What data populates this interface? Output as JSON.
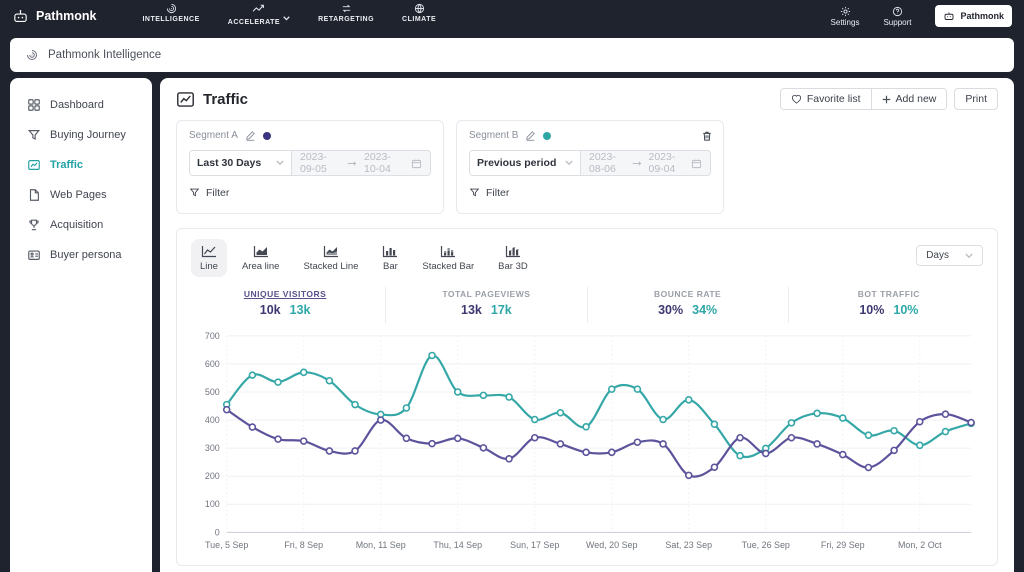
{
  "colors": {
    "navbar_bg": "#1F232E",
    "accent_teal": "#2FA7A7",
    "accent_purple": "#3D3870",
    "line_purple": "#5B539B",
    "line_teal": "#35A7A7"
  },
  "topnav": {
    "brand": "Pathmonk",
    "items": [
      {
        "label": "INTELLIGENCE"
      },
      {
        "label": "ACCELERATE"
      },
      {
        "label": "RETARGETING"
      },
      {
        "label": "CLIMATE"
      }
    ],
    "settings_label": "Settings",
    "support_label": "Support",
    "account_badge": "Pathmonk"
  },
  "breadcrumb": {
    "title": "Pathmonk Intelligence"
  },
  "sidebar": {
    "items": [
      {
        "label": "Dashboard"
      },
      {
        "label": "Buying Journey"
      },
      {
        "label": "Traffic",
        "active": true
      },
      {
        "label": "Web Pages"
      },
      {
        "label": "Acquisition"
      },
      {
        "label": "Buyer persona"
      }
    ]
  },
  "page": {
    "title": "Traffic",
    "favorite_button": "Favorite list",
    "add_new_button": "Add new",
    "print_button": "Print"
  },
  "segments": [
    {
      "name": "Segment A",
      "dot_color": "#3B3580",
      "period_select": "Last 30 Days",
      "date_from": "2023-09-05",
      "date_to": "2023-10-04",
      "filter_label": "Filter"
    },
    {
      "name": "Segment B",
      "dot_color": "#2FA7A7",
      "period_select": "Previous period",
      "date_from": "2023-08-06",
      "date_to": "2023-09-04",
      "filter_label": "Filter"
    }
  ],
  "chart_controls": {
    "tabs": [
      {
        "label": "Line",
        "active": true
      },
      {
        "label": "Area line"
      },
      {
        "label": "Stacked Line"
      },
      {
        "label": "Bar"
      },
      {
        "label": "Stacked Bar"
      },
      {
        "label": "Bar 3D"
      }
    ],
    "interval_select": "Days"
  },
  "metrics": [
    {
      "label": "UNIQUE VISITORS",
      "segment_a": "10k",
      "segment_b": "13k",
      "active": true
    },
    {
      "label": "TOTAL PAGEVIEWS",
      "segment_a": "13k",
      "segment_b": "17k"
    },
    {
      "label": "BOUNCE RATE",
      "segment_a": "30%",
      "segment_b": "34%"
    },
    {
      "label": "BOT TRAFFIC",
      "segment_a": "10%",
      "segment_b": "10%"
    }
  ],
  "chart_data": {
    "type": "line",
    "x_dates": [
      "2023-09-05",
      "2023-09-06",
      "2023-09-07",
      "2023-09-08",
      "2023-09-09",
      "2023-09-10",
      "2023-09-11",
      "2023-09-12",
      "2023-09-13",
      "2023-09-14",
      "2023-09-15",
      "2023-09-16",
      "2023-09-17",
      "2023-09-18",
      "2023-09-19",
      "2023-09-20",
      "2023-09-21",
      "2023-09-22",
      "2023-09-23",
      "2023-09-24",
      "2023-09-25",
      "2023-09-26",
      "2023-09-27",
      "2023-09-28",
      "2023-09-29",
      "2023-09-30",
      "2023-10-01",
      "2023-10-02",
      "2023-10-03",
      "2023-10-04"
    ],
    "tick_every": 3,
    "tick_labels": [
      "Tue, 5 Sep",
      "Fri, 8 Sep",
      "Mon, 11 Sep",
      "Thu, 14 Sep",
      "Sun, 17 Sep",
      "Wed, 20 Sep",
      "Sat, 23 Sep",
      "Tue, 26 Sep",
      "Fri, 29 Sep",
      "Mon, 2 Oct"
    ],
    "ylim": [
      0,
      700
    ],
    "yticks": [
      0,
      100,
      200,
      300,
      400,
      500,
      600,
      700
    ],
    "grid": true,
    "legend": "none",
    "series": [
      {
        "name": "Segment B",
        "color": "#35A7A7",
        "values": [
          455,
          560,
          535,
          570,
          540,
          455,
          420,
          443,
          630,
          500,
          488,
          482,
          402,
          426,
          376,
          510,
          510,
          402,
          472,
          385,
          273,
          299,
          390,
          424,
          407,
          346,
          362,
          310,
          359,
          388
        ]
      },
      {
        "name": "Segment A",
        "color": "#5B539B",
        "values": [
          437,
          375,
          332,
          325,
          290,
          290,
          400,
          335,
          316,
          335,
          301,
          262,
          337,
          315,
          285,
          285,
          321,
          315,
          203,
          232,
          337,
          281,
          337,
          315,
          277,
          231,
          292,
          394,
          421,
          391
        ]
      }
    ]
  }
}
